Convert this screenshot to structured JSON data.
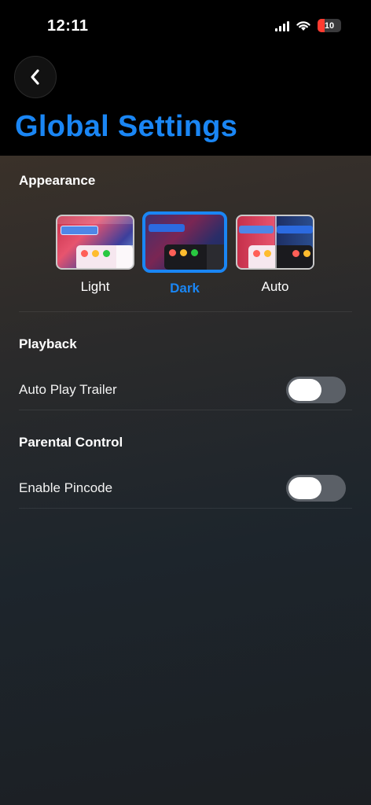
{
  "status_bar": {
    "time": "12:11",
    "battery_level": "10"
  },
  "header": {
    "title": "Global Settings"
  },
  "appearance": {
    "section_title": "Appearance",
    "options": [
      {
        "label": "Light",
        "selected": false
      },
      {
        "label": "Dark",
        "selected": true
      },
      {
        "label": "Auto",
        "selected": false
      }
    ]
  },
  "playback": {
    "section_title": "Playback",
    "auto_play_trailer": {
      "label": "Auto Play Trailer",
      "enabled": false
    }
  },
  "parental_control": {
    "section_title": "Parental Control",
    "enable_pincode": {
      "label": "Enable Pincode",
      "enabled": false
    }
  },
  "colors": {
    "accent": "#1a86f4",
    "toggle_off": "#5b6067"
  }
}
